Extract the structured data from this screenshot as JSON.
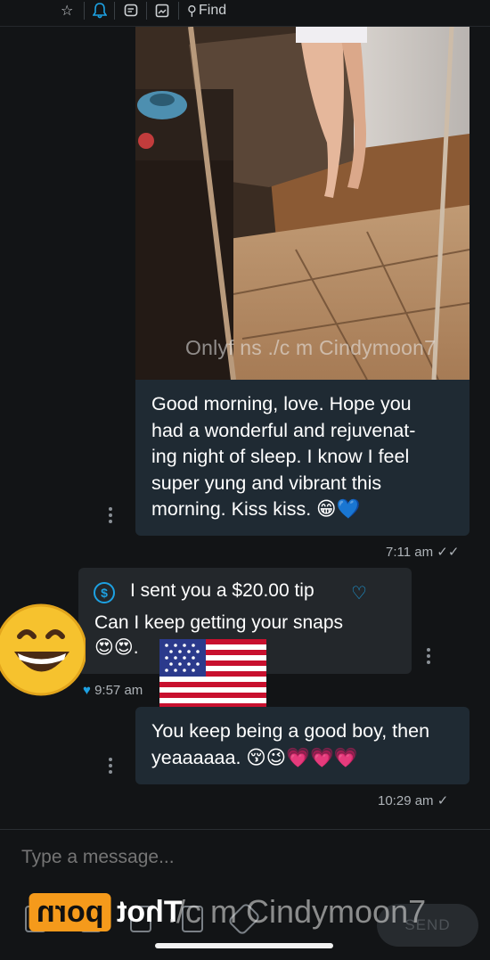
{
  "toolbar": {
    "icons": [
      "star-icon",
      "bell-icon",
      "chat-icon",
      "image-icon",
      "search-icon"
    ],
    "find_label": "Find",
    "accent_color": "#1da1e2"
  },
  "media": {
    "watermark": "Onlyf ns ./c m Cindymoon7"
  },
  "messages": [
    {
      "text": "Good morning, love. Hope you had a wonderful and rejuvenating night of sleep. I know I feel super yung and vibrant this morning. Kiss kiss. 😁💙",
      "lines": [
        "Good morning, love. Hope you",
        "had a wonderful and rejuvenat-",
        "ing night of sleep. I know I feel",
        "super yung and vibrant this",
        "morning. Kiss kiss. 😁💙"
      ],
      "time": "7:11 am",
      "status": "read"
    },
    {
      "tip_label": "I sent you a $20.00 tip",
      "text_line1": "Can I keep getting your snaps",
      "text_line2": "😍😍.",
      "time": "9:57 am",
      "liked": true
    },
    {
      "lines": [
        "You keep being a good boy, then",
        "yeaaaaaa. 😚😉💗💗💗"
      ],
      "time": "10:29 am",
      "status": "sent"
    }
  ],
  "composer": {
    "placeholder": "Type a message...",
    "send_label": "SEND",
    "tools": [
      "attach-icon",
      "camera-icon",
      "gallery-icon",
      "poll-icon",
      "price-tag-icon"
    ]
  },
  "overlay": {
    "logo_left": "Thot",
    "logo_right": "porn",
    "watermark": "./c m Cindymoon7"
  }
}
